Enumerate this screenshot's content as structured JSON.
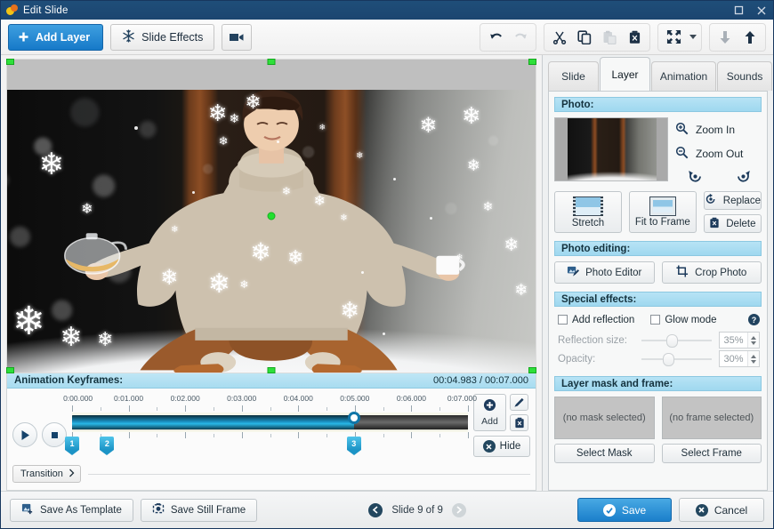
{
  "window": {
    "title": "Edit Slide",
    "app_icon": "app-logo-icon",
    "maximize_label": "□",
    "close_label": "×"
  },
  "toolbar": {
    "add_layer": "Add Layer",
    "slide_effects": "Slide Effects",
    "video_button": "video-camera",
    "undo": "undo",
    "redo": "redo",
    "cut": "cut",
    "copy": "copy",
    "paste": "paste",
    "delete": "delete",
    "fit": "fit-to-screen",
    "fit_dropdown": "fit-options",
    "move_down": "move-down",
    "move_up": "move-up"
  },
  "canvas": {
    "center_handle": "layer-center-point",
    "selection": "layer-selection-handles"
  },
  "keyframes": {
    "header": "Animation Keyframes:",
    "time_current": "00:04.983",
    "time_total": "00:07.000",
    "time_display": "00:04.983 / 00:07.000",
    "play": "play",
    "stop": "stop",
    "ruler_labels": [
      "0:00.000",
      "0:01.000",
      "0:02.000",
      "0:03.000",
      "0:04.000",
      "0:05.000",
      "0:06.000",
      "0:07.000"
    ],
    "duration_seconds": 7,
    "markers": [
      {
        "label": "1",
        "time": 0.0
      },
      {
        "label": "2",
        "time": 0.62
      },
      {
        "label": "3",
        "time": 4.983
      }
    ],
    "playhead_time": 4.983,
    "add_label": "Add",
    "edit_label": "edit-keyframe",
    "delete_label": "delete-keyframe",
    "hide_label": "Hide",
    "transition_label": "Transition"
  },
  "tabs": [
    {
      "label": "Slide",
      "active": false
    },
    {
      "label": "Layer",
      "active": true
    },
    {
      "label": "Animation",
      "active": false
    },
    {
      "label": "Sounds",
      "active": false
    }
  ],
  "panel": {
    "photo": {
      "header": "Photo:",
      "zoom_in": "Zoom In",
      "zoom_out": "Zoom Out",
      "rotate_left": "rotate-left",
      "rotate_right": "rotate-right",
      "stretch": "Stretch",
      "fit_to_frame": "Fit to Frame",
      "replace": "Replace",
      "delete": "Delete"
    },
    "photo_editing": {
      "header": "Photo editing:",
      "photo_editor": "Photo Editor",
      "crop_photo": "Crop Photo"
    },
    "special_effects": {
      "header": "Special effects:",
      "add_reflection": "Add reflection",
      "add_reflection_checked": false,
      "glow_mode": "Glow mode",
      "glow_mode_checked": false,
      "help": "?",
      "reflection_size_label": "Reflection size:",
      "reflection_size_value": "35%",
      "opacity_label": "Opacity:",
      "opacity_value": "30%"
    },
    "mask_frame": {
      "header": "Layer mask and frame:",
      "no_mask": "(no mask selected)",
      "no_frame": "(no frame selected)",
      "select_mask": "Select Mask",
      "select_frame": "Select Frame"
    }
  },
  "footer": {
    "save_as_template": "Save As Template",
    "save_still_frame": "Save Still Frame",
    "slide_counter": "Slide 9 of 9",
    "prev": "previous-slide",
    "next": "next-slide",
    "save": "Save",
    "cancel": "Cancel"
  },
  "colors": {
    "titlebar": "#1f4e79",
    "accent_blue": "#1b7fcb",
    "section_header": "#a8dcf0",
    "handle_green": "#2ee03a",
    "timeline_cyan": "#19b0de"
  }
}
